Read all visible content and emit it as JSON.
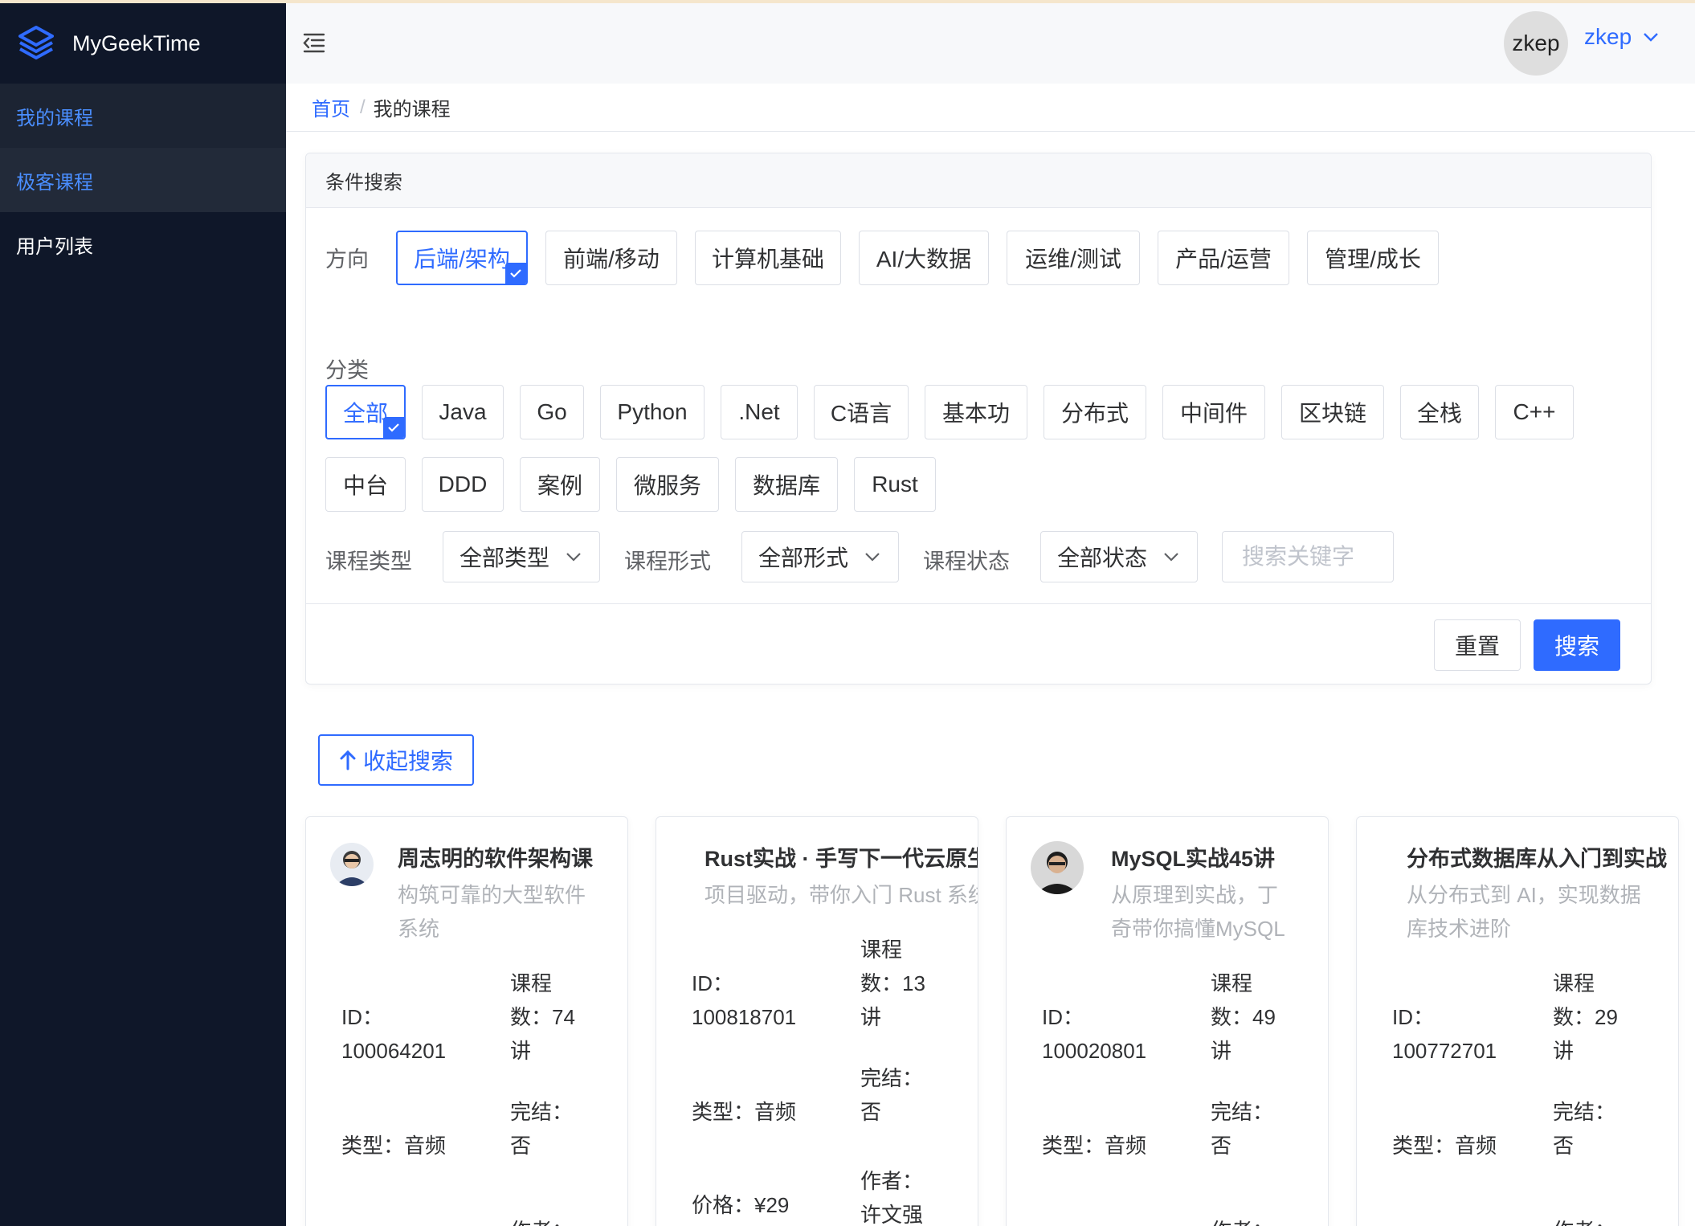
{
  "brand": {
    "name": "MyGeekTime"
  },
  "sidebar": {
    "items": [
      {
        "label": "我的课程"
      },
      {
        "label": "极客课程"
      },
      {
        "label": "用户列表"
      }
    ]
  },
  "header": {
    "avatar_text": "zkep",
    "user_name": "zkep"
  },
  "breadcrumb": {
    "home": "首页",
    "separator": "/",
    "current": "我的课程"
  },
  "search": {
    "title": "条件搜索",
    "direction_label": "方向",
    "directions": [
      "后端/架构",
      "前端/移动",
      "计算机基础",
      "AI/大数据",
      "运维/测试",
      "产品/运营",
      "管理/成长"
    ],
    "category_label": "分类",
    "categories": [
      "全部",
      "Java",
      "Go",
      "Python",
      ".Net",
      "C语言",
      "基本功",
      "分布式",
      "中间件",
      "区块链",
      "全栈",
      "C++",
      "中台",
      "DDD",
      "案例",
      "微服务",
      "数据库",
      "Rust"
    ],
    "course_type_label": "课程类型",
    "course_type_value": "全部类型",
    "course_form_label": "课程形式",
    "course_form_value": "全部形式",
    "course_status_label": "课程状态",
    "course_status_value": "全部状态",
    "keyword_placeholder": "搜索关键字",
    "reset_label": "重置",
    "search_label": "搜索"
  },
  "collapse_label": "收起搜索",
  "courses": [
    {
      "title": "周志明的软件架构课",
      "sub1": "构筑可靠的大型软件",
      "sub2": "系统",
      "id_label": "ID：",
      "id": "100064201",
      "count_l1": "课程",
      "count_l2": "数：74",
      "count_l3": "讲",
      "type": "类型：音频",
      "finished_l1": "完结：",
      "finished_l2": "否",
      "author_l1": "作者："
    },
    {
      "title": "Rust实战 · 手写下一代云原生消息队列",
      "sub1": "项目驱动，带你入门 Rust 系统编程",
      "id_label": "ID：",
      "id": "100818701",
      "count_l1": "课程",
      "count_l2": "数：13",
      "count_l3": "讲",
      "type": "类型：音频",
      "finished_l1": "完结：",
      "finished_l2": "否",
      "price": "价格：¥29",
      "author_l1": "作者：",
      "author_l2": "许文强"
    },
    {
      "title": "MySQL实战45讲",
      "sub1": "从原理到实战，丁",
      "sub2": "奇带你搞懂MySQL",
      "id_label": "ID：",
      "id": "100020801",
      "count_l1": "课程",
      "count_l2": "数：49",
      "count_l3": "讲",
      "type": "类型：音频",
      "finished_l1": "完结：",
      "finished_l2": "否",
      "author_l1": "作者："
    },
    {
      "title": "分布式数据库从入门到实战",
      "sub1": "从分布式到 AI，实现数据",
      "sub2": "库技术进阶",
      "id_label": "ID：",
      "id": "100772701",
      "count_l1": "课程",
      "count_l2": "数：29",
      "count_l3": "讲",
      "type": "类型：音频",
      "finished_l1": "完结：",
      "finished_l2": "否",
      "author_l1": "作者："
    }
  ],
  "colors": {
    "accent": "#2f6bff",
    "sidebar_bg": "#0f1729"
  }
}
